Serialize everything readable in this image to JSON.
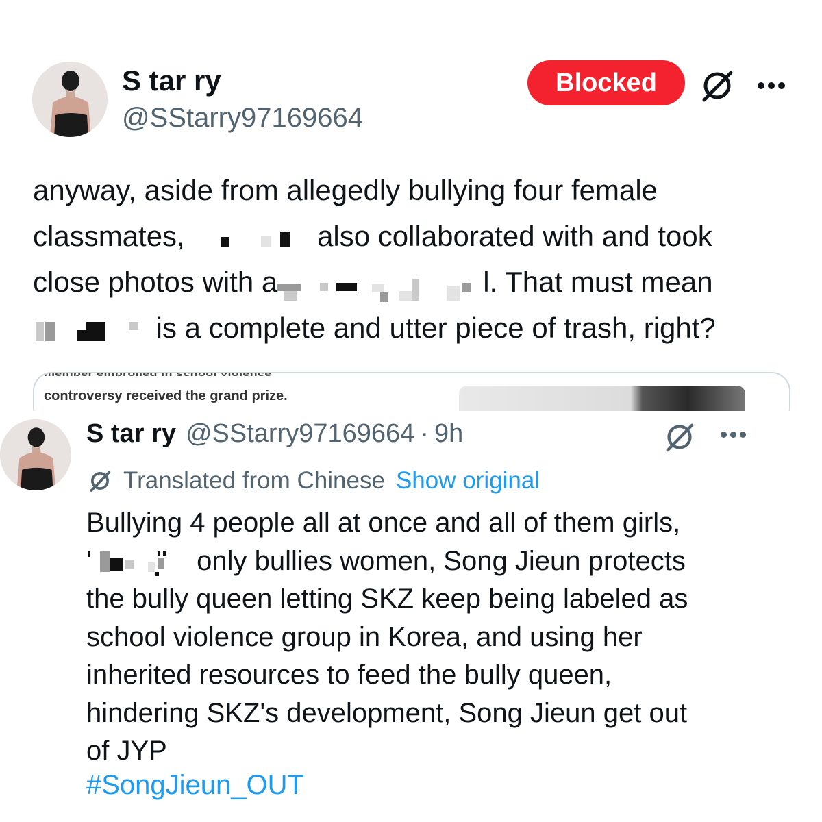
{
  "post1": {
    "display_name": "S tar ry",
    "handle": "@SStarry97169664",
    "blocked_label": "Blocked",
    "grok_icon": "grok-icon",
    "more_icon": "more-dots-icon",
    "lines": [
      "anyway, aside from allegedly bullying four female",
      "classmates,",
      "also collaborated with and took",
      "close photos with a",
      "l. That must mean",
      "is a complete and utter piece of trash, right?"
    ],
    "quote": {
      "partial_line": "member embroiled in school violence",
      "line": "controversy received the grand prize."
    }
  },
  "post2": {
    "display_name": "S tar ry",
    "handle": "@SStarry97169664",
    "separator": "·",
    "time": "9h",
    "translated_label": "Translated from Chinese",
    "show_original": "Show original",
    "lines": [
      "Bullying 4 people all at once and all of them girls,",
      "only bullies women, Song Jieun protects",
      "the bully queen letting SKZ keep being labeled as",
      "school violence group in Korea, and using her",
      "inherited resources to feed the bully queen,",
      "hindering SKZ's development, Song Jieun get out",
      "of JYP"
    ],
    "hashtag": "#SongJieun_OUT"
  },
  "colors": {
    "text": "#0f1419",
    "muted": "#536471",
    "blocked_red": "#f4212e",
    "link_blue": "#1d9bf0",
    "border": "#cfd9de"
  }
}
